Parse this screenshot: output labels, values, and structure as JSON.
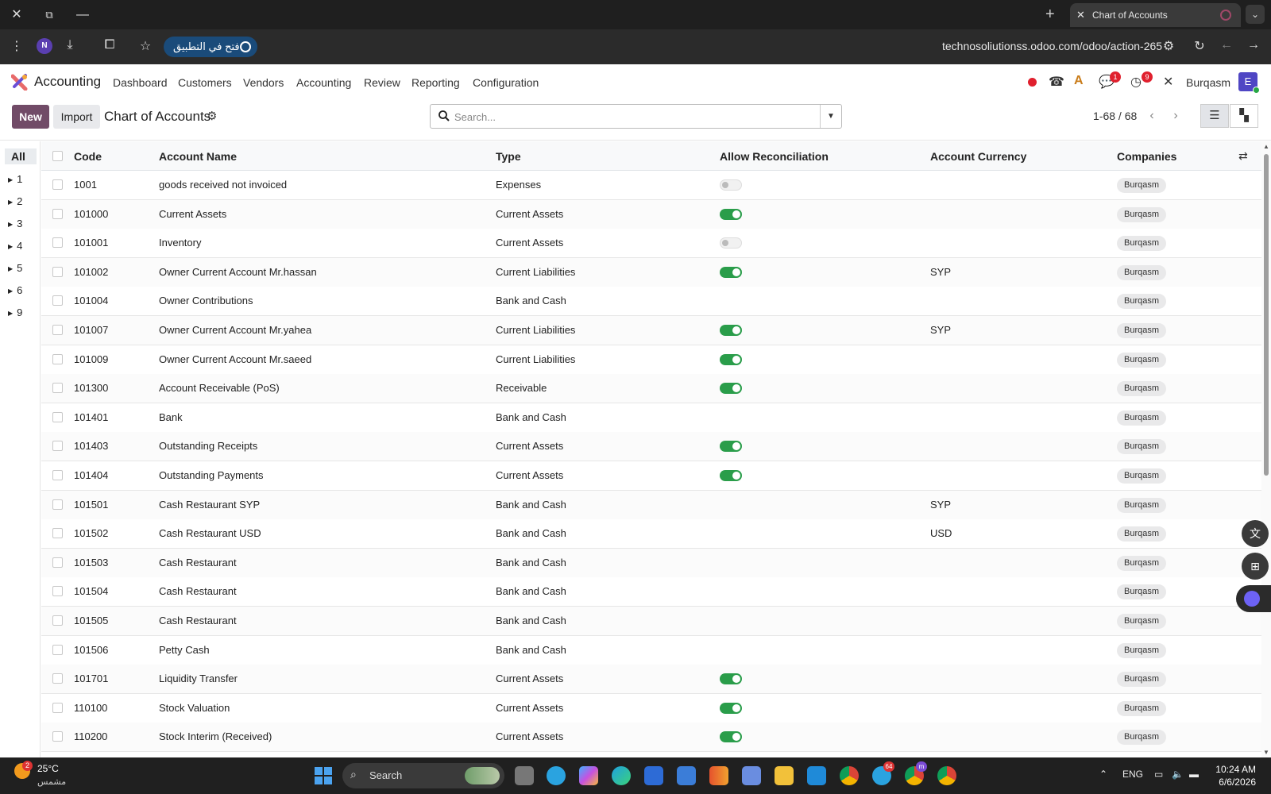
{
  "browser": {
    "tab_title": "Chart of Accounts",
    "profile_initial": "N",
    "open_in_app_label": "فتح في التطبيق",
    "url": "technosoliutionss.odoo.com/odoo/action-265"
  },
  "app": {
    "name": "Accounting",
    "menu": [
      "Dashboard",
      "Customers",
      "Vendors",
      "Accounting",
      "Review",
      "Reporting",
      "Configuration"
    ],
    "messages_badge": "1",
    "activities_badge": "9",
    "company": "Burqasm",
    "user_initial": "E"
  },
  "control": {
    "new_label": "New",
    "import_label": "Import",
    "title": "Chart of Accounts",
    "search_placeholder": "Search...",
    "pager": "1-68 / 68"
  },
  "side_panel": {
    "all_label": "All",
    "groups": [
      "1",
      "2",
      "3",
      "4",
      "5",
      "6",
      "9"
    ]
  },
  "table": {
    "columns": {
      "code": "Code",
      "name": "Account Name",
      "type": "Type",
      "reconcile": "Allow Reconciliation",
      "currency": "Account Currency",
      "companies": "Companies"
    },
    "rows": [
      {
        "code": "1001",
        "name": "goods received not invoiced",
        "type": "Expenses",
        "reconcile": "off",
        "currency": "",
        "company": "Burqasm"
      },
      {
        "code": "101000",
        "name": "Current Assets",
        "type": "Current Assets",
        "reconcile": "on",
        "currency": "",
        "company": "Burqasm"
      },
      {
        "code": "101001",
        "name": "Inventory",
        "type": "Current Assets",
        "reconcile": "off",
        "currency": "",
        "company": "Burqasm"
      },
      {
        "code": "101002",
        "name": "Owner Current Account Mr.hassan",
        "type": "Current Liabilities",
        "reconcile": "on",
        "currency": "SYP",
        "company": "Burqasm"
      },
      {
        "code": "101004",
        "name": "Owner Contributions",
        "type": "Bank and Cash",
        "reconcile": "none",
        "currency": "",
        "company": "Burqasm"
      },
      {
        "code": "101007",
        "name": "Owner Current Account Mr.yahea",
        "type": "Current Liabilities",
        "reconcile": "on",
        "currency": "SYP",
        "company": "Burqasm"
      },
      {
        "code": "101009",
        "name": "Owner Current Account Mr.saeed",
        "type": "Current Liabilities",
        "reconcile": "on",
        "currency": "",
        "company": "Burqasm"
      },
      {
        "code": "101300",
        "name": "Account Receivable (PoS)",
        "type": "Receivable",
        "reconcile": "on",
        "currency": "",
        "company": "Burqasm"
      },
      {
        "code": "101401",
        "name": "Bank",
        "type": "Bank and Cash",
        "reconcile": "none",
        "currency": "",
        "company": "Burqasm"
      },
      {
        "code": "101403",
        "name": "Outstanding Receipts",
        "type": "Current Assets",
        "reconcile": "on",
        "currency": "",
        "company": "Burqasm"
      },
      {
        "code": "101404",
        "name": "Outstanding Payments",
        "type": "Current Assets",
        "reconcile": "on",
        "currency": "",
        "company": "Burqasm"
      },
      {
        "code": "101501",
        "name": "Cash Restaurant SYP",
        "type": "Bank and Cash",
        "reconcile": "none",
        "currency": "SYP",
        "company": "Burqasm"
      },
      {
        "code": "101502",
        "name": "Cash Restaurant USD",
        "type": "Bank and Cash",
        "reconcile": "none",
        "currency": "USD",
        "company": "Burqasm"
      },
      {
        "code": "101503",
        "name": "Cash Restaurant",
        "type": "Bank and Cash",
        "reconcile": "none",
        "currency": "",
        "company": "Burqasm"
      },
      {
        "code": "101504",
        "name": "Cash Restaurant",
        "type": "Bank and Cash",
        "reconcile": "none",
        "currency": "",
        "company": "Burqasm"
      },
      {
        "code": "101505",
        "name": "Cash Restaurant",
        "type": "Bank and Cash",
        "reconcile": "none",
        "currency": "",
        "company": "Burqasm"
      },
      {
        "code": "101506",
        "name": "Petty Cash",
        "type": "Bank and Cash",
        "reconcile": "none",
        "currency": "",
        "company": "Burqasm"
      },
      {
        "code": "101701",
        "name": "Liquidity Transfer",
        "type": "Current Assets",
        "reconcile": "on",
        "currency": "",
        "company": "Burqasm"
      },
      {
        "code": "110100",
        "name": "Stock Valuation",
        "type": "Current Assets",
        "reconcile": "on",
        "currency": "",
        "company": "Burqasm"
      },
      {
        "code": "110200",
        "name": "Stock Interim (Received)",
        "type": "Current Assets",
        "reconcile": "on",
        "currency": "",
        "company": "Burqasm"
      }
    ]
  },
  "taskbar": {
    "weather_badge": "2",
    "temperature": "25°C",
    "weather_desc": "مشمس",
    "search_label": "Search",
    "telegram_badge": "64",
    "chrome_badge": "m",
    "language": "ENG",
    "time": "10:24 AM",
    "date": "6/6/2026"
  },
  "colors": {
    "brand": "#714b67",
    "toggle_on": "#2a9d4a"
  }
}
